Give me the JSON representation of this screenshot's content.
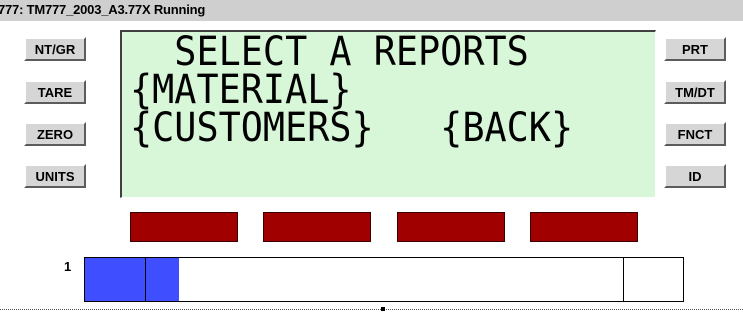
{
  "window": {
    "title": "777: TM777_2003_A3.77X Running"
  },
  "left_buttons": [
    "NT/GR",
    "TARE",
    "ZERO",
    "UNITS"
  ],
  "right_buttons": [
    "PRT",
    "TM/DT",
    "FNCT",
    "ID"
  ],
  "display": {
    "line1": "  SELECT A REPORTS",
    "line2": "{MATERIAL}",
    "line3": "{CUSTOMERS}   {BACK}",
    "background_color": "#d8f6d8"
  },
  "softkeys": {
    "count": 4,
    "color": "#a00000"
  },
  "bargraph": {
    "label": "1",
    "fill_fraction": 0.157,
    "fill_color": "#3f4fff"
  }
}
